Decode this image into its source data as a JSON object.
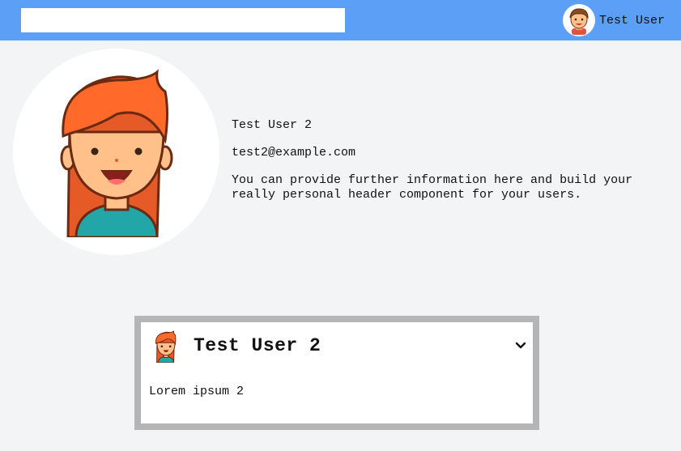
{
  "header": {
    "search": {
      "value": "",
      "placeholder": ""
    },
    "user": {
      "name": "Test User",
      "avatar_icon": "boy-avatar-icon"
    }
  },
  "profile": {
    "avatar_icon": "girl-avatar-icon",
    "name": "Test User 2",
    "email": "test2@example.com",
    "description": "You can provide further information here and build your really personal header component for your users."
  },
  "card": {
    "avatar_icon": "girl-avatar-icon",
    "title": "Test User 2",
    "toggle_icon": "chevron-down-icon",
    "body": "Lorem ipsum 2"
  },
  "colors": {
    "topbar": "#5b9ff7",
    "background": "#f3f4f6",
    "card_border": "#b5b5b5",
    "hair": "#ff6a2b",
    "skin": "#ffc08a",
    "shirt": "#23a6a8"
  }
}
